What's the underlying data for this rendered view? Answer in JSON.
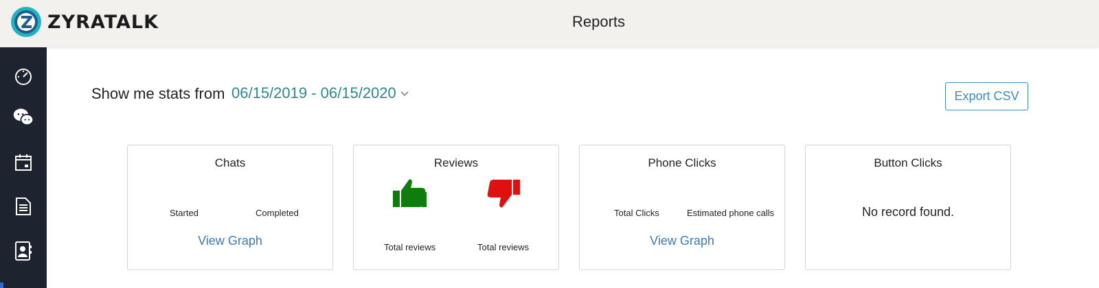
{
  "app": {
    "brand": "ZYRATALK",
    "page_title": "Reports"
  },
  "sidebar": {
    "items": [
      {
        "icon": "dashboard-gauge-icon"
      },
      {
        "icon": "chat-bubbles-icon"
      },
      {
        "icon": "calendar-icon"
      },
      {
        "icon": "document-icon"
      },
      {
        "icon": "contacts-icon"
      }
    ]
  },
  "filter": {
    "label": "Show me stats from",
    "date_range": "06/15/2019 - 06/15/2020"
  },
  "actions": {
    "export_label": "Export CSV"
  },
  "cards": {
    "chats": {
      "title": "Chats",
      "started": "Started",
      "completed": "Completed",
      "link": "View Graph"
    },
    "reviews": {
      "title": "Reviews",
      "positive_label": "Total reviews",
      "negative_label": "Total reviews"
    },
    "phone_clicks": {
      "title": "Phone Clicks",
      "total": "Total Clicks",
      "estimated": "Estimated phone calls",
      "link": "View Graph"
    },
    "button_clicks": {
      "title": "Button Clicks",
      "empty": "No record found."
    }
  },
  "colors": {
    "accent": "#2a8a8f",
    "link": "#3d7ab8",
    "thumbs_up": "#0e7d0e",
    "thumbs_down": "#e01010",
    "sidebar_bg": "#1e2330"
  }
}
